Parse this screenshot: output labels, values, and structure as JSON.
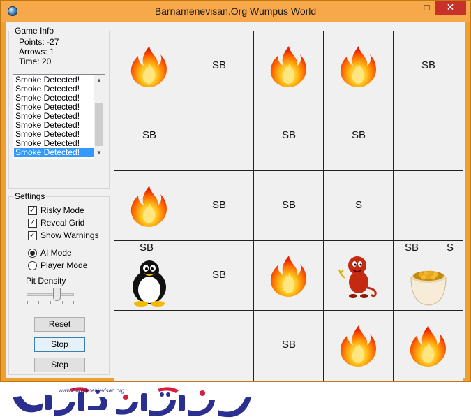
{
  "window": {
    "title": "Barnamenevisan.Org Wumpus World"
  },
  "game_info": {
    "legend": "Game Info",
    "points": "Points: -27",
    "arrows": "Arrows: 1",
    "time": "Time: 20"
  },
  "log": {
    "items": [
      "Smoke Detected!",
      "Smoke Detected!",
      "Smoke Detected!",
      "Smoke Detected!",
      "Smoke Detected!",
      "Smoke Detected!",
      "Smoke Detected!",
      "Smoke Detected!",
      "Smoke Detected!"
    ],
    "selected_index": 8
  },
  "settings": {
    "legend": "Settings",
    "risky_mode": "Risky Mode",
    "reveal_grid": "Reveal Grid",
    "show_warnings": "Show Warnings",
    "ai_mode": "AI Mode",
    "player_mode": "Player Mode",
    "pit_density": "Pit Density"
  },
  "buttons": {
    "reset": "Reset",
    "stop": "Stop",
    "step": "Step"
  },
  "grid": {
    "rows": [
      [
        {
          "icon": "fire"
        },
        {
          "text": "SB"
        },
        {
          "icon": "fire"
        },
        {
          "icon": "fire"
        },
        {
          "text": "SB"
        }
      ],
      [
        {
          "text": "SB"
        },
        {},
        {
          "text": "SB"
        },
        {
          "text": "SB"
        },
        {}
      ],
      [
        {
          "icon": "fire"
        },
        {
          "text": "SB"
        },
        {
          "text": "SB"
        },
        {
          "text": "S"
        },
        {}
      ],
      [
        {
          "text": "SB",
          "icon": "penguin"
        },
        {
          "text": "SB"
        },
        {
          "icon": "fire"
        },
        {
          "icon": "wumpus"
        },
        {
          "text": "SB",
          "text2": "S",
          "icon": "gold"
        }
      ],
      [
        {},
        {},
        {
          "text": "SB"
        },
        {
          "icon": "fire"
        },
        {
          "icon": "fire"
        }
      ]
    ]
  },
  "footer": {
    "url": "www.BarnameNevisan.org"
  },
  "colors": {
    "titlebar": "#f6a84a",
    "close": "#c7312a",
    "selection": "#3399ff",
    "logo_blue": "#2b2f8f",
    "logo_red": "#d81e3f"
  }
}
